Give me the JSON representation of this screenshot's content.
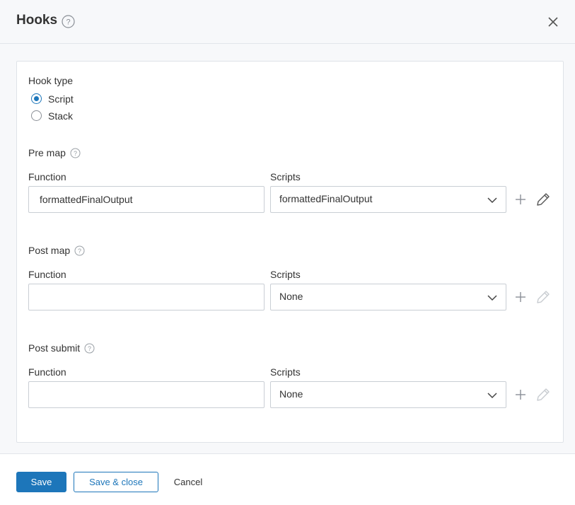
{
  "dialog": {
    "title": "Hooks",
    "close_icon": "close-icon",
    "help_icon": "help-circle-icon"
  },
  "hook_type": {
    "label": "Hook type",
    "options": [
      {
        "label": "Script",
        "selected": true
      },
      {
        "label": "Stack",
        "selected": false
      }
    ]
  },
  "sections": [
    {
      "title": "Pre map",
      "function_label": "Function",
      "function_value": "formattedFinalOutput",
      "scripts_label": "Scripts",
      "scripts_value": "formattedFinalOutput",
      "edit_enabled": true
    },
    {
      "title": "Post map",
      "function_label": "Function",
      "function_value": "",
      "scripts_label": "Scripts",
      "scripts_value": "None",
      "edit_enabled": false
    },
    {
      "title": "Post submit",
      "function_label": "Function",
      "function_value": "",
      "scripts_label": "Scripts",
      "scripts_value": "None",
      "edit_enabled": false
    }
  ],
  "footer": {
    "save_label": "Save",
    "save_close_label": "Save & close",
    "cancel_label": "Cancel"
  },
  "colors": {
    "accent": "#1d76ba",
    "background": "#f7f8fa",
    "border": "#c9ced4"
  }
}
